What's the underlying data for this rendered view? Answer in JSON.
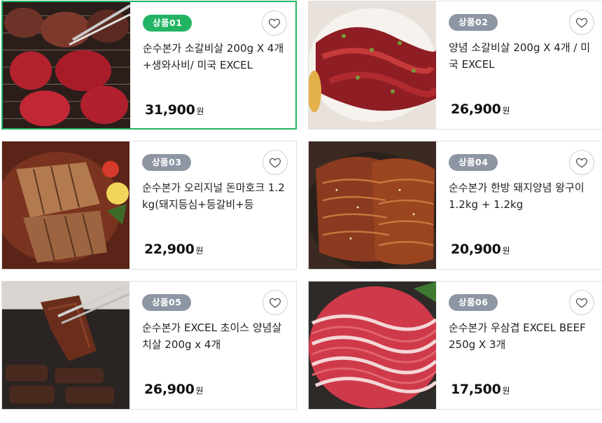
{
  "products": [
    {
      "badge": "상품01",
      "title": "순수본가 소갈비살 200g X 4개+생와사비/ 미국 EXCEL",
      "price": "31,900",
      "unit": "원",
      "image": "grilled-beef-rib",
      "selected": true
    },
    {
      "badge": "상품02",
      "title": "양념 소갈비살 200g X 4개 / 미국 EXCEL",
      "price": "26,900",
      "unit": "원",
      "image": "seasoned-beef-rib",
      "selected": false
    },
    {
      "badge": "상품03",
      "title": "순수본가 오리지널 돈마호크 1.2kg(돼지등심+등갈비+등",
      "price": "22,900",
      "unit": "원",
      "image": "pork-tomahawk",
      "selected": false
    },
    {
      "badge": "상품04",
      "title": "순수본가 한방 돼지양념 왕구이 1.2kg + 1.2kg",
      "price": "20,900",
      "unit": "원",
      "image": "seasoned-pork",
      "selected": false
    },
    {
      "badge": "상품05",
      "title": "순수본가 EXCEL 초이스 양념살치살 200g x 4개",
      "price": "26,900",
      "unit": "원",
      "image": "tongs-beef",
      "selected": false
    },
    {
      "badge": "상품06",
      "title": "순수본가 우삼겹 EXCEL BEEF 250g X 3개",
      "price": "17,500",
      "unit": "원",
      "image": "beef-brisket-slices",
      "selected": false
    }
  ],
  "colors": {
    "accent": "#22b463",
    "badge_gray": "#8e96a4",
    "border": "#e1e1e1"
  },
  "icons": {
    "wishlist": "heart-outline-icon"
  }
}
